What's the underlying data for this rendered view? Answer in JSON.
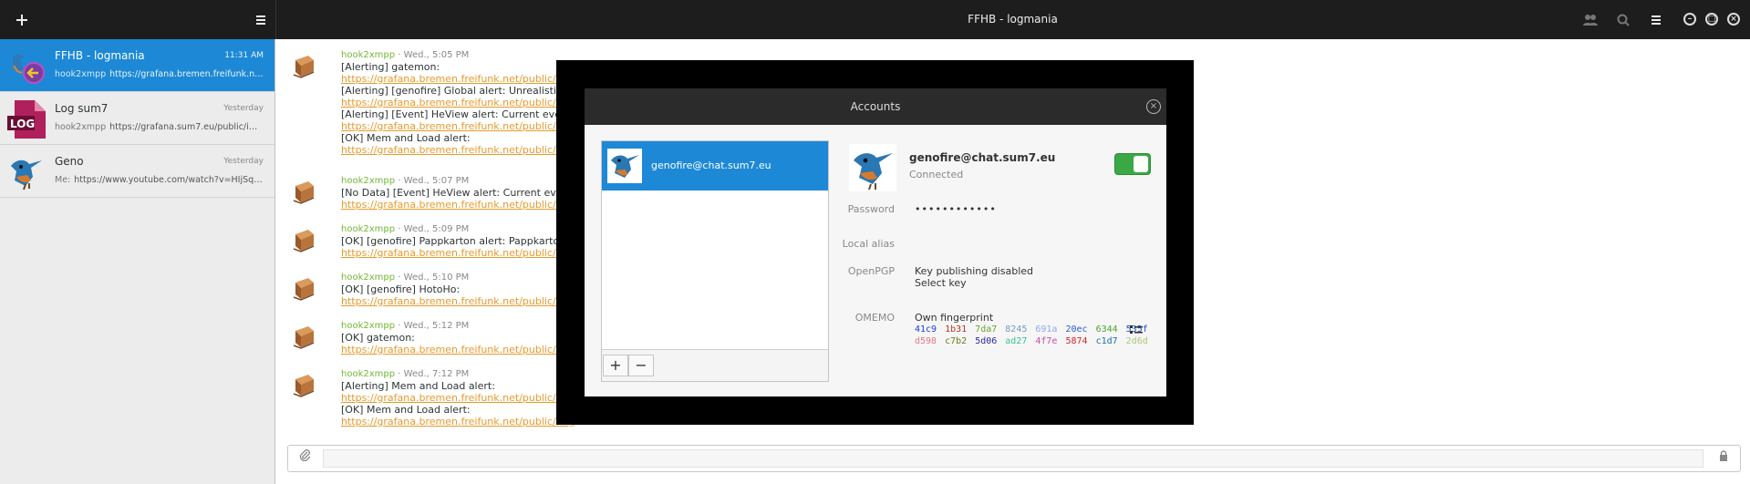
{
  "header": {
    "title": "FFHB - logmania",
    "add_icon": "plus-icon",
    "menu_icon": "hamburger-menu-icon"
  },
  "sidebar": {
    "conversations": [
      {
        "name": "FFHB - logmania",
        "time": "11:31 AM",
        "from": "hook2xmpp",
        "preview": "https://grafana.bremen.freifunk.net/public/img/attachments/...",
        "active": true
      },
      {
        "name": "Log sum7",
        "time": "Yesterday",
        "from": "hook2xmpp",
        "preview": "https://grafana.sum7.eu/public/img/attachments/...",
        "active": false
      },
      {
        "name": "Geno",
        "time": "Yesterday",
        "from": "Me:",
        "preview": "https://www.youtube.com/watch?v=HIjSquJ7y...",
        "active": false
      }
    ]
  },
  "chat": {
    "messages": [
      {
        "sender": "hook2xmpp",
        "time": "Wed., 5:05 PM",
        "lines": [
          {
            "t": "[Alerting] gatemon:",
            "link": false
          },
          {
            "t": "https://grafana.bremen.freifunk.net/public/img",
            "link": true
          },
          {
            "t": "[Alerting] [genofire] Global alert: Unrealistic Glo",
            "link": false
          },
          {
            "t": "https://grafana.bremen.freifunk.net/public/img",
            "link": true
          },
          {
            "t": "[Alerting] [Event] HeView alert: Current event do",
            "link": false
          },
          {
            "t": "https://grafana.bremen.freifunk.net/public/img",
            "link": true
          },
          {
            "t": "[OK] Mem and Load alert:",
            "link": false
          },
          {
            "t": "https://grafana.bremen.freifunk.net/public/img",
            "link": true
          }
        ]
      },
      {
        "sender": "hook2xmpp",
        "time": "Wed., 5:07 PM",
        "lines": [
          {
            "t": "[No Data] [Event] HeView alert: Current event do",
            "link": false
          },
          {
            "t": "https://grafana.bremen.freifunk.net/public/img",
            "link": true
          }
        ]
      },
      {
        "sender": "hook2xmpp",
        "time": "Wed., 5:09 PM",
        "lines": [
          {
            "t": "[OK] [genofire] Pappkarton alert: Pappkarton do",
            "link": false
          },
          {
            "t": "https://grafana.bremen.freifunk.net/public/img",
            "link": true
          }
        ]
      },
      {
        "sender": "hook2xmpp",
        "time": "Wed., 5:10 PM",
        "lines": [
          {
            "t": "[OK] [genofire] HotoHo:",
            "link": false
          },
          {
            "t": "https://grafana.bremen.freifunk.net/public/img",
            "link": true
          }
        ]
      },
      {
        "sender": "hook2xmpp",
        "time": "Wed., 5:12 PM",
        "lines": [
          {
            "t": "[OK] gatemon:",
            "link": false
          },
          {
            "t": "https://grafana.bremen.freifunk.net/public/img",
            "link": true
          }
        ]
      },
      {
        "sender": "hook2xmpp",
        "time": "Wed., 7:12 PM",
        "lines": [
          {
            "t": "[Alerting] Mem and Load alert:",
            "link": false
          },
          {
            "t": "https://grafana.bremen.freifunk.net/public/img",
            "link": true
          },
          {
            "t": "[OK] Mem and Load alert:",
            "link": false
          },
          {
            "t": "https://grafana.bremen.freifunk.net/public/img",
            "link": true
          }
        ]
      }
    ]
  },
  "dialog": {
    "title": "Accounts",
    "account_list": [
      {
        "jid": "genofire@chat.sum7.eu"
      }
    ],
    "add_label": "+",
    "remove_label": "−",
    "account": {
      "jid": "genofire@chat.sum7.eu",
      "status": "Connected",
      "enabled": true,
      "password_label": "Password",
      "password_value": "••••••••••••",
      "local_alias_label": "Local alias",
      "openpgp_label": "OpenPGP",
      "openpgp_status": "Key publishing disabled",
      "openpgp_select": "Select key",
      "omemo_label": "OMEMO",
      "omemo_title": "Own fingerprint",
      "fingerprint": [
        [
          [
            "41c9",
            "#1d3fd6"
          ],
          [
            "1b31",
            "#c0341d"
          ],
          [
            "7da7",
            "#6aa234"
          ],
          [
            "8245",
            "#6f9fbf"
          ],
          [
            "691a",
            "#8ea8e8"
          ],
          [
            "20ec",
            "#2b5fd1"
          ],
          [
            "6344",
            "#4ba52c"
          ],
          [
            "535f",
            "#1f4fc6"
          ]
        ],
        [
          [
            "d598",
            "#e07a86"
          ],
          [
            "c7b2",
            "#6a7a1a"
          ],
          [
            "5d06",
            "#2a2aa0"
          ],
          [
            "ad27",
            "#3cc09b"
          ],
          [
            "4f7e",
            "#c24fa8"
          ],
          [
            "5874",
            "#d4222a"
          ],
          [
            "c1d7",
            "#1d6fa8"
          ],
          [
            "2d6d",
            "#a7c977"
          ]
        ]
      ]
    }
  },
  "colors": {
    "accent": "#1d89d6",
    "header_bg": "#1d1d1d",
    "link": "#e99a2b",
    "sender": "#73b735",
    "switch_on": "#3aa845"
  }
}
